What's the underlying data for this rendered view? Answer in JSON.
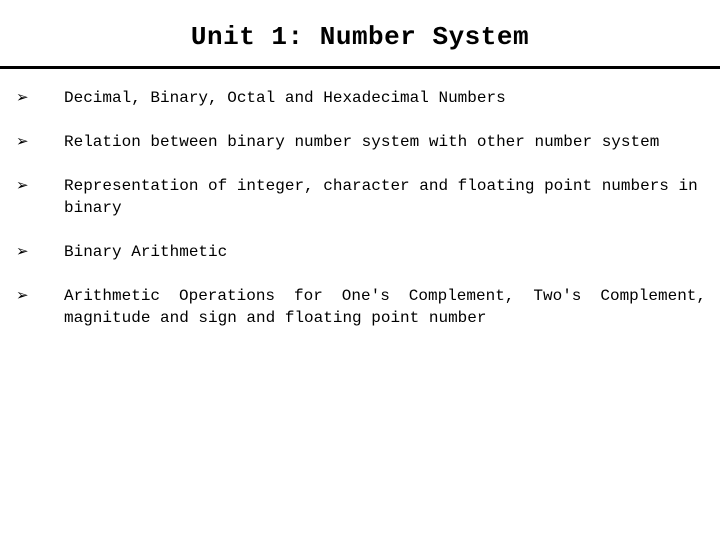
{
  "title": "Unit 1: Number System",
  "bullet_glyph": "➢",
  "items": [
    {
      "text": "Decimal, Binary, Octal and Hexadecimal Numbers",
      "justified": false
    },
    {
      "text": "Relation between binary number system with other number system",
      "justified": false
    },
    {
      "text": "Representation of integer, character and floating point numbers in binary",
      "justified": false
    },
    {
      "text": "Binary Arithmetic",
      "justified": false
    },
    {
      "text": "Arithmetic Operations for One's Complement, Two's Complement, magnitude and sign and floating point number",
      "justified": true
    }
  ]
}
